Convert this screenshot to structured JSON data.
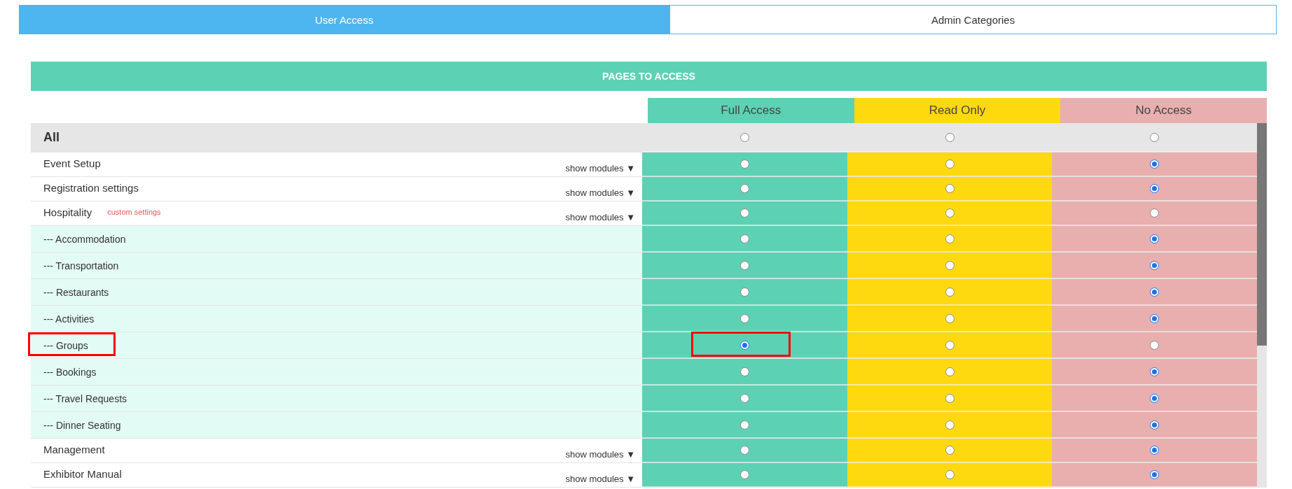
{
  "tabs": [
    {
      "label": "User Access",
      "selected": true
    },
    {
      "label": "Admin Categories",
      "selected": false
    }
  ],
  "section_title": "PAGES TO ACCESS",
  "columns": [
    {
      "label": "Full Access",
      "color": "#5dd1b4"
    },
    {
      "label": "Read Only",
      "color": "#fed90f"
    },
    {
      "label": "No Access",
      "color": "#e8afae"
    }
  ],
  "all_row": {
    "label": "All",
    "selected": [
      false,
      false,
      false
    ]
  },
  "rows": [
    {
      "kind": "module",
      "label": "Event Setup",
      "toggle": "show modules ▼",
      "selected": [
        false,
        false,
        true
      ]
    },
    {
      "kind": "module",
      "label": "Registration settings",
      "toggle": "show modules ▼",
      "selected": [
        false,
        false,
        true
      ]
    },
    {
      "kind": "module",
      "label": "Hospitality",
      "note": "custom settings",
      "toggle": "show modules ▼",
      "selected": [
        false,
        false,
        false
      ]
    },
    {
      "kind": "submodule",
      "label": "--- Accommodation",
      "selected": [
        false,
        false,
        true
      ]
    },
    {
      "kind": "submodule",
      "label": "--- Transportation",
      "selected": [
        false,
        false,
        true
      ]
    },
    {
      "kind": "submodule",
      "label": "--- Restaurants",
      "selected": [
        false,
        false,
        true
      ]
    },
    {
      "kind": "submodule",
      "label": "--- Activities",
      "selected": [
        false,
        false,
        true
      ]
    },
    {
      "kind": "submodule",
      "label": "--- Groups",
      "highlighted": true,
      "selected": [
        true,
        false,
        false
      ]
    },
    {
      "kind": "submodule",
      "label": "--- Bookings",
      "selected": [
        false,
        false,
        true
      ]
    },
    {
      "kind": "submodule",
      "label": "--- Travel Requests",
      "selected": [
        false,
        false,
        true
      ]
    },
    {
      "kind": "submodule",
      "label": "--- Dinner Seating",
      "selected": [
        false,
        false,
        true
      ]
    },
    {
      "kind": "module",
      "label": "Management",
      "toggle": "show modules ▼",
      "selected": [
        false,
        false,
        true
      ]
    },
    {
      "kind": "module",
      "label": "Exhibitor Manual",
      "toggle": "show modules ▼",
      "selected": [
        false,
        false,
        true
      ]
    }
  ]
}
